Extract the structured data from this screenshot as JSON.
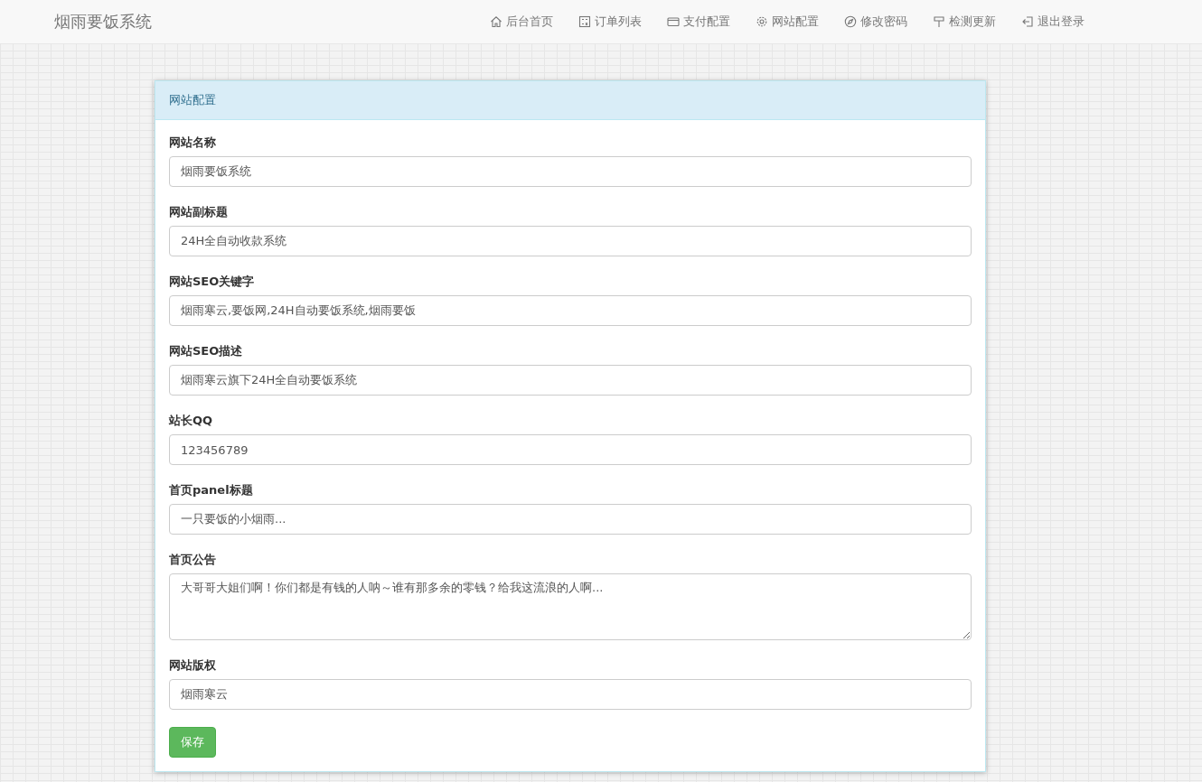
{
  "navbar": {
    "brand": "烟雨要饭系统",
    "items": [
      {
        "label": "后台首页"
      },
      {
        "label": "订单列表"
      },
      {
        "label": "支付配置"
      },
      {
        "label": "网站配置"
      },
      {
        "label": "修改密码"
      },
      {
        "label": "检测更新"
      },
      {
        "label": "退出登录"
      }
    ]
  },
  "panel": {
    "title": "网站配置",
    "fields": [
      {
        "kind": "input",
        "label": "网站名称",
        "value": "烟雨要饭系统"
      },
      {
        "kind": "input",
        "label": "网站副标题",
        "value": "24H全自动收款系统"
      },
      {
        "kind": "input",
        "label": "网站SEO关键字",
        "value": "烟雨寒云,要饭网,24H自动要饭系统,烟雨要饭"
      },
      {
        "kind": "input",
        "label": "网站SEO描述",
        "value": "烟雨寒云旗下24H全自动要饭系统"
      },
      {
        "kind": "input",
        "label": "站长QQ",
        "value": "123456789"
      },
      {
        "kind": "input",
        "label": "首页panel标题",
        "value": "一只要饭的小烟雨..."
      },
      {
        "kind": "textarea",
        "label": "首页公告",
        "value": "大哥哥大姐们啊！你们都是有钱的人呐～谁有那多余的零钱？给我这流浪的人啊..."
      },
      {
        "kind": "input",
        "label": "网站版权",
        "value": "烟雨寒云"
      }
    ],
    "save_button": "保存"
  }
}
